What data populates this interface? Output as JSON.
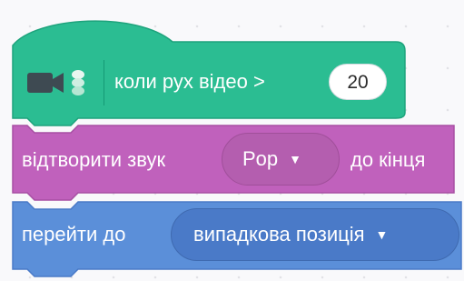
{
  "colors": {
    "hat_block": "#2bbd92",
    "sound_block": "#c061bc",
    "motion_block": "#5b8fd9"
  },
  "hat_block": {
    "icon": "video-camera-icon",
    "label": "коли рух відео >",
    "value": "20"
  },
  "sound_block": {
    "label_before": "відтворити звук",
    "dropdown_value": "Pop",
    "label_after": "до кінця"
  },
  "motion_block": {
    "label": "перейти до",
    "dropdown_value": "випадкова позиція"
  },
  "dropdown_caret": "▼"
}
